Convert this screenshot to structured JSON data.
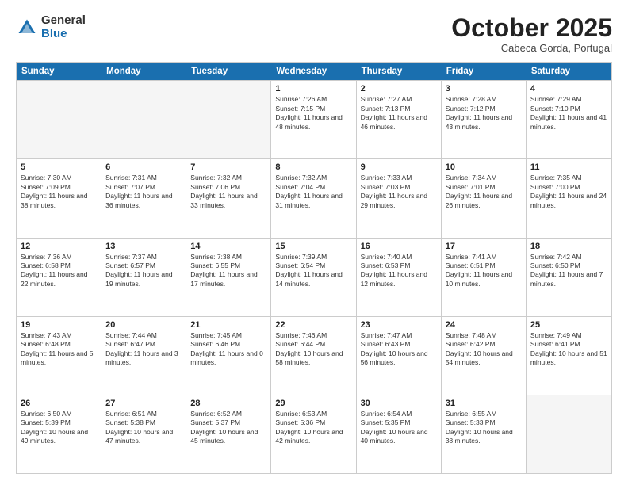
{
  "logo": {
    "general": "General",
    "blue": "Blue"
  },
  "header": {
    "title": "October 2025",
    "subtitle": "Cabeca Gorda, Portugal"
  },
  "weekdays": [
    "Sunday",
    "Monday",
    "Tuesday",
    "Wednesday",
    "Thursday",
    "Friday",
    "Saturday"
  ],
  "rows": [
    [
      {
        "day": "",
        "empty": true
      },
      {
        "day": "",
        "empty": true
      },
      {
        "day": "",
        "empty": true
      },
      {
        "day": "1",
        "sunrise": "7:26 AM",
        "sunset": "7:15 PM",
        "daylight": "11 hours and 48 minutes."
      },
      {
        "day": "2",
        "sunrise": "7:27 AM",
        "sunset": "7:13 PM",
        "daylight": "11 hours and 46 minutes."
      },
      {
        "day": "3",
        "sunrise": "7:28 AM",
        "sunset": "7:12 PM",
        "daylight": "11 hours and 43 minutes."
      },
      {
        "day": "4",
        "sunrise": "7:29 AM",
        "sunset": "7:10 PM",
        "daylight": "11 hours and 41 minutes."
      }
    ],
    [
      {
        "day": "5",
        "sunrise": "7:30 AM",
        "sunset": "7:09 PM",
        "daylight": "11 hours and 38 minutes."
      },
      {
        "day": "6",
        "sunrise": "7:31 AM",
        "sunset": "7:07 PM",
        "daylight": "11 hours and 36 minutes."
      },
      {
        "day": "7",
        "sunrise": "7:32 AM",
        "sunset": "7:06 PM",
        "daylight": "11 hours and 33 minutes."
      },
      {
        "day": "8",
        "sunrise": "7:32 AM",
        "sunset": "7:04 PM",
        "daylight": "11 hours and 31 minutes."
      },
      {
        "day": "9",
        "sunrise": "7:33 AM",
        "sunset": "7:03 PM",
        "daylight": "11 hours and 29 minutes."
      },
      {
        "day": "10",
        "sunrise": "7:34 AM",
        "sunset": "7:01 PM",
        "daylight": "11 hours and 26 minutes."
      },
      {
        "day": "11",
        "sunrise": "7:35 AM",
        "sunset": "7:00 PM",
        "daylight": "11 hours and 24 minutes."
      }
    ],
    [
      {
        "day": "12",
        "sunrise": "7:36 AM",
        "sunset": "6:58 PM",
        "daylight": "11 hours and 22 minutes."
      },
      {
        "day": "13",
        "sunrise": "7:37 AM",
        "sunset": "6:57 PM",
        "daylight": "11 hours and 19 minutes."
      },
      {
        "day": "14",
        "sunrise": "7:38 AM",
        "sunset": "6:55 PM",
        "daylight": "11 hours and 17 minutes."
      },
      {
        "day": "15",
        "sunrise": "7:39 AM",
        "sunset": "6:54 PM",
        "daylight": "11 hours and 14 minutes."
      },
      {
        "day": "16",
        "sunrise": "7:40 AM",
        "sunset": "6:53 PM",
        "daylight": "11 hours and 12 minutes."
      },
      {
        "day": "17",
        "sunrise": "7:41 AM",
        "sunset": "6:51 PM",
        "daylight": "11 hours and 10 minutes."
      },
      {
        "day": "18",
        "sunrise": "7:42 AM",
        "sunset": "6:50 PM",
        "daylight": "11 hours and 7 minutes."
      }
    ],
    [
      {
        "day": "19",
        "sunrise": "7:43 AM",
        "sunset": "6:48 PM",
        "daylight": "11 hours and 5 minutes."
      },
      {
        "day": "20",
        "sunrise": "7:44 AM",
        "sunset": "6:47 PM",
        "daylight": "11 hours and 3 minutes."
      },
      {
        "day": "21",
        "sunrise": "7:45 AM",
        "sunset": "6:46 PM",
        "daylight": "11 hours and 0 minutes."
      },
      {
        "day": "22",
        "sunrise": "7:46 AM",
        "sunset": "6:44 PM",
        "daylight": "10 hours and 58 minutes."
      },
      {
        "day": "23",
        "sunrise": "7:47 AM",
        "sunset": "6:43 PM",
        "daylight": "10 hours and 56 minutes."
      },
      {
        "day": "24",
        "sunrise": "7:48 AM",
        "sunset": "6:42 PM",
        "daylight": "10 hours and 54 minutes."
      },
      {
        "day": "25",
        "sunrise": "7:49 AM",
        "sunset": "6:41 PM",
        "daylight": "10 hours and 51 minutes."
      }
    ],
    [
      {
        "day": "26",
        "sunrise": "6:50 AM",
        "sunset": "5:39 PM",
        "daylight": "10 hours and 49 minutes."
      },
      {
        "day": "27",
        "sunrise": "6:51 AM",
        "sunset": "5:38 PM",
        "daylight": "10 hours and 47 minutes."
      },
      {
        "day": "28",
        "sunrise": "6:52 AM",
        "sunset": "5:37 PM",
        "daylight": "10 hours and 45 minutes."
      },
      {
        "day": "29",
        "sunrise": "6:53 AM",
        "sunset": "5:36 PM",
        "daylight": "10 hours and 42 minutes."
      },
      {
        "day": "30",
        "sunrise": "6:54 AM",
        "sunset": "5:35 PM",
        "daylight": "10 hours and 40 minutes."
      },
      {
        "day": "31",
        "sunrise": "6:55 AM",
        "sunset": "5:33 PM",
        "daylight": "10 hours and 38 minutes."
      },
      {
        "day": "",
        "empty": true
      }
    ]
  ]
}
